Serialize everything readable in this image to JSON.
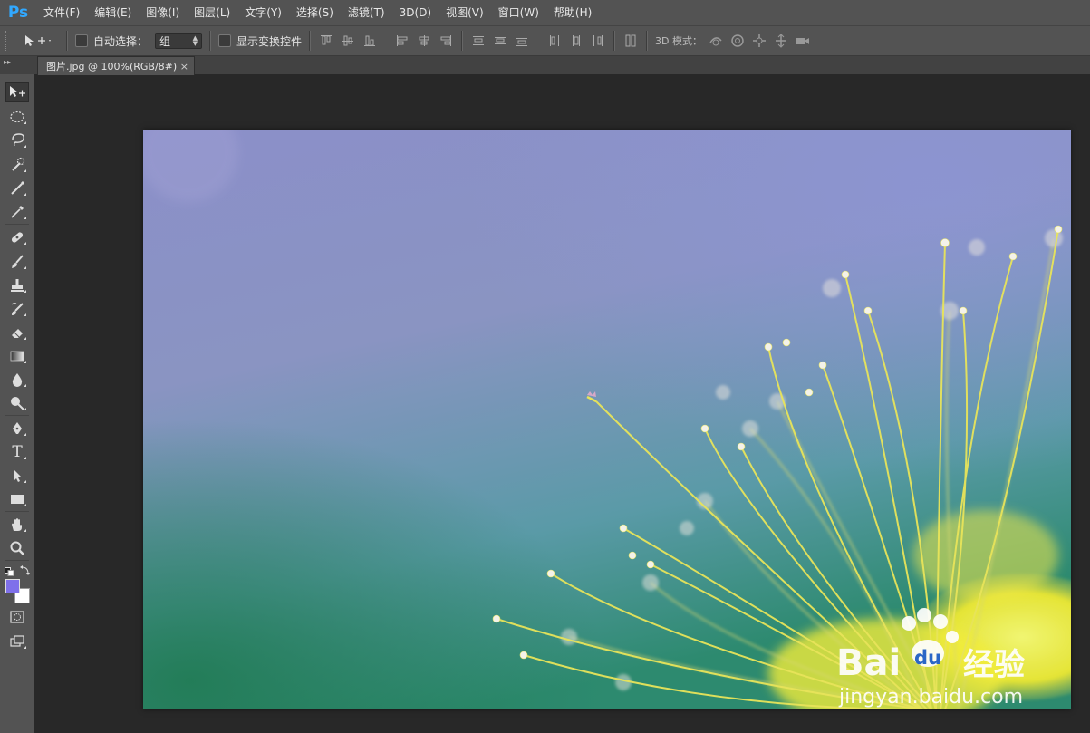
{
  "app": {
    "logo": "Ps",
    "accent": "#31a8ff"
  },
  "menu": [
    {
      "label": "文件(F)"
    },
    {
      "label": "编辑(E)"
    },
    {
      "label": "图像(I)"
    },
    {
      "label": "图层(L)"
    },
    {
      "label": "文字(Y)"
    },
    {
      "label": "选择(S)"
    },
    {
      "label": "滤镜(T)"
    },
    {
      "label": "3D(D)"
    },
    {
      "label": "视图(V)"
    },
    {
      "label": "窗口(W)"
    },
    {
      "label": "帮助(H)"
    }
  ],
  "options": {
    "auto_select_label": "自动选择：",
    "auto_select_value": "组",
    "show_transform_label": "显示变换控件",
    "mode_3d_label": "3D 模式："
  },
  "document": {
    "tab_title": "图片.jpg @ 100%(RGB/8#)",
    "close_glyph": "×"
  },
  "colors": {
    "foreground": "#7f70ea",
    "background": "#ffffff"
  },
  "watermark": {
    "brand_latin": "Bai",
    "brand_du": "du",
    "brand_cn": "经验",
    "url": "jingyan.baidu.com"
  },
  "tools": [
    {
      "name": "move-tool"
    },
    {
      "name": "elliptical-marquee-tool"
    },
    {
      "name": "lasso-tool"
    },
    {
      "name": "quick-selection-tool"
    },
    {
      "name": "crop-tool"
    },
    {
      "name": "eyedropper-tool"
    },
    {
      "name": "spot-healing-tool"
    },
    {
      "name": "brush-tool"
    },
    {
      "name": "clone-stamp-tool"
    },
    {
      "name": "history-brush-tool"
    },
    {
      "name": "eraser-tool"
    },
    {
      "name": "gradient-tool"
    },
    {
      "name": "blur-tool"
    },
    {
      "name": "dodge-tool"
    },
    {
      "name": "pen-tool"
    },
    {
      "name": "type-tool",
      "glyph": "T"
    },
    {
      "name": "path-selection-tool"
    },
    {
      "name": "rectangle-tool"
    },
    {
      "name": "hand-tool"
    },
    {
      "name": "zoom-tool"
    }
  ]
}
